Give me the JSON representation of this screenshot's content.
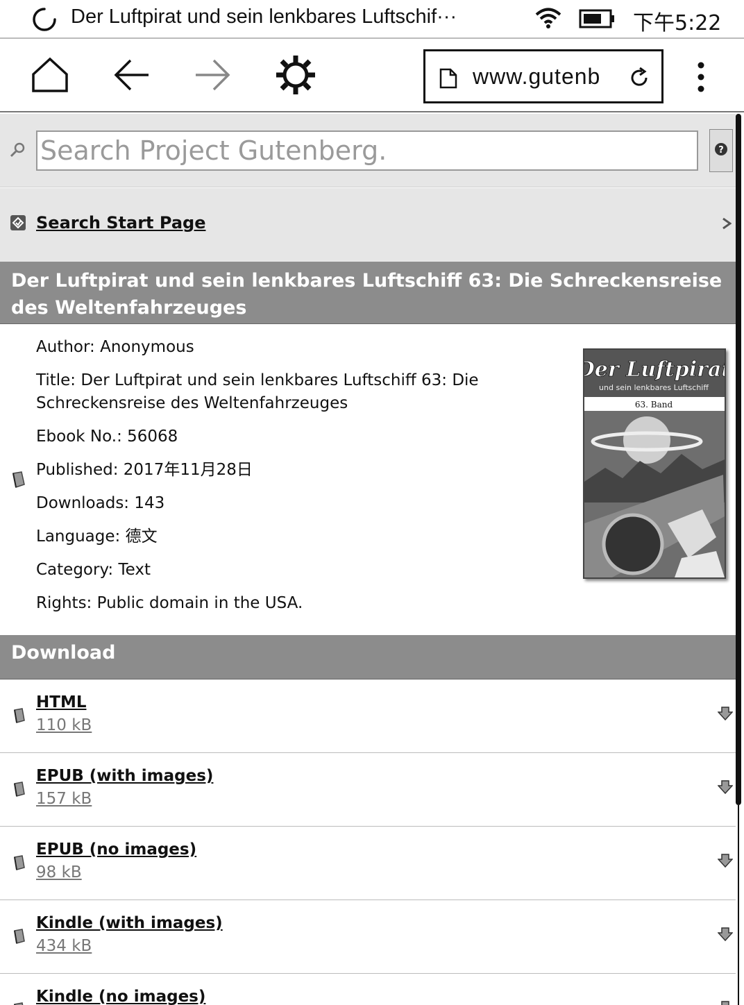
{
  "status_bar": {
    "page_title": "Der Luftpirat und sein lenkbares Luftschif···",
    "time": "下午5:22"
  },
  "toolbar": {
    "url": "www.gutenb"
  },
  "search": {
    "placeholder": "Search Project Gutenberg.",
    "start_page_link": "Search Start Page"
  },
  "book": {
    "heading": "Der Luftpirat und sein lenkbares Luftschiff 63: Die Schreckensreise des Weltenfahrzeuges",
    "author": "Author: Anonymous",
    "title_line1": "Title: Der Luftpirat und sein lenkbares Luftschiff 63: Die",
    "title_line2": "Schreckensreise des Weltenfahrzeuges",
    "ebook_no": "Ebook No.: 56068",
    "published": "Published: 2017年11月28日",
    "downloads": "Downloads: 143",
    "language": "Language: 德文",
    "category": "Category: Text",
    "rights": "Rights: Public domain in the USA.",
    "cover": {
      "title_script": "Der Luftpirat",
      "subtitle": "und sein lenkbares Luftschiff",
      "band": "63. Band"
    }
  },
  "download": {
    "heading": "Download",
    "items": [
      {
        "format": "HTML",
        "size": "110 kB"
      },
      {
        "format": "EPUB (with images)",
        "size": "157 kB"
      },
      {
        "format": "EPUB (no images)",
        "size": "98 kB"
      },
      {
        "format": "Kindle (with images)",
        "size": "434 kB"
      },
      {
        "format": "Kindle (no images)",
        "size": ""
      }
    ]
  }
}
